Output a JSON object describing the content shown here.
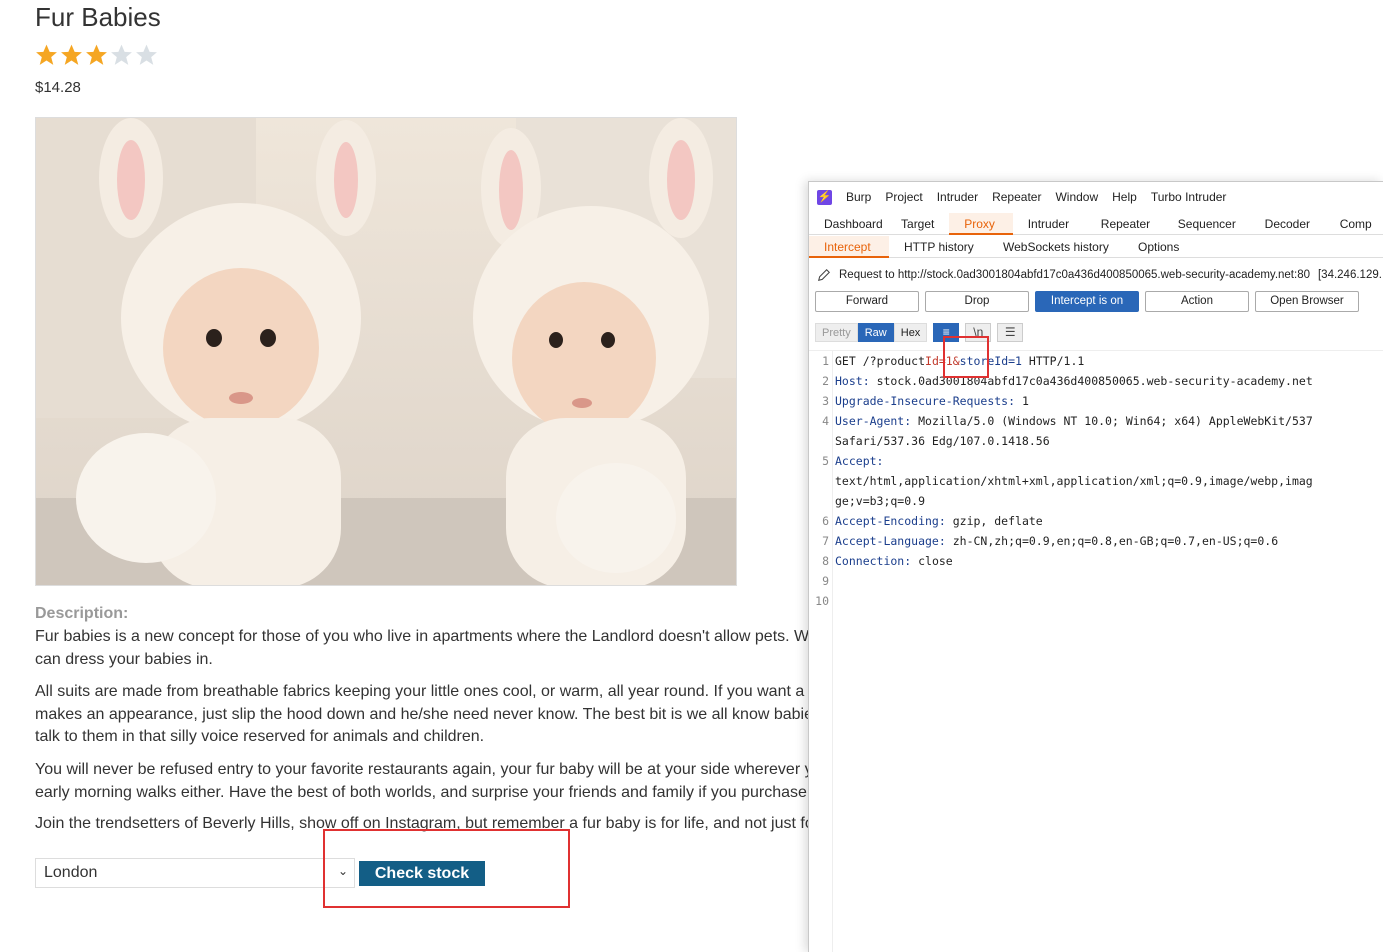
{
  "product": {
    "title": "Fur Babies",
    "rating": 3,
    "rating_max": 5,
    "price": "$14.28",
    "image_alt": "two babies in white bunny suits"
  },
  "description": {
    "label": "Description:",
    "p1": "Fur babies is a new concept for those of you who live in apartments where the Landlord doesn't allow pets. W can dress your babies in.",
    "p2": "All suits are made from breathable fabrics keeping your little ones cool, or warm, all year round. If you want a makes an appearance, just slip the hood down and he/she need never know. The best bit is we all know babie talk to them in that silly voice reserved for animals and children.",
    "p3": "You will never be refused entry to your favorite restaurants again, your fur baby will be at your side wherever y early morning walks either. Have the best of both worlds, and surprise your friends and family if you purchase",
    "p4": "Join the trendsetters of Beverly Hills, show off on Instagram, but remember a fur baby is for life, and not just fo"
  },
  "stock": {
    "store_selected": "London",
    "check_label": "Check stock"
  },
  "colors": {
    "star_filled": "#f5a623",
    "star_empty": "#d9dfe4",
    "check_button": "#135e86",
    "burp_accent": "#e8630a",
    "highlight": "#e03131"
  },
  "burp": {
    "logo": "⚡",
    "menu": [
      "Burp",
      "Project",
      "Intruder",
      "Repeater",
      "Window",
      "Help",
      "Turbo Intruder"
    ],
    "main_tabs": [
      "Dashboard",
      "Target",
      "Proxy",
      "Intruder",
      "Repeater",
      "Sequencer",
      "Decoder",
      "Comp"
    ],
    "sub_tabs": [
      "Intercept",
      "HTTP history",
      "WebSockets history",
      "Options"
    ],
    "request_to": "Request to http://stock.0ad3001804abfd17c0a436d400850065.web-security-academy.net:80",
    "request_ip": "[34.246.129.",
    "buttons": [
      "Forward",
      "Drop",
      "Intercept is on",
      "Action",
      "Open Browser"
    ],
    "view_modes": [
      "Pretty",
      "Raw",
      "Hex"
    ],
    "view_icons": [
      "wrap-icon",
      "newline-icon",
      "menu-icon"
    ],
    "newline_glyph": "\\n",
    "lines": [
      {
        "n": "1",
        "method": "GET",
        "path": "/?product",
        "param1": "Id=1&",
        "param2": "storeId=1",
        "proto": "HTTP/1.1"
      },
      {
        "n": "2",
        "key": "Host:",
        "val": "stock.0ad3001804abfd17c0a436d400850065.web-security-academy.net"
      },
      {
        "n": "3",
        "key": "Upgrade-Insecure-Requests:",
        "val": "1"
      },
      {
        "n": "4",
        "key": "User-Agent:",
        "val": "Mozilla/5.0 (Windows NT 10.0; Win64; x64) AppleWebKit/537"
      },
      {
        "n": "",
        "text": "Safari/537.36 Edg/107.0.1418.56"
      },
      {
        "n": "5",
        "key": "Accept:",
        "val": ""
      },
      {
        "n": "",
        "text": "text/html,application/xhtml+xml,application/xml;q=0.9,image/webp,imag"
      },
      {
        "n": "",
        "text": "ge;v=b3;q=0.9"
      },
      {
        "n": "6",
        "key": "Accept-Encoding:",
        "val": "gzip, deflate"
      },
      {
        "n": "7",
        "key": "Accept-Language:",
        "val": "zh-CN,zh;q=0.9,en;q=0.8,en-GB;q=0.7,en-US;q=0.6"
      },
      {
        "n": "8",
        "key": "Connection:",
        "val": "close"
      },
      {
        "n": "9",
        "text": ""
      },
      {
        "n": "10",
        "text": ""
      }
    ]
  }
}
